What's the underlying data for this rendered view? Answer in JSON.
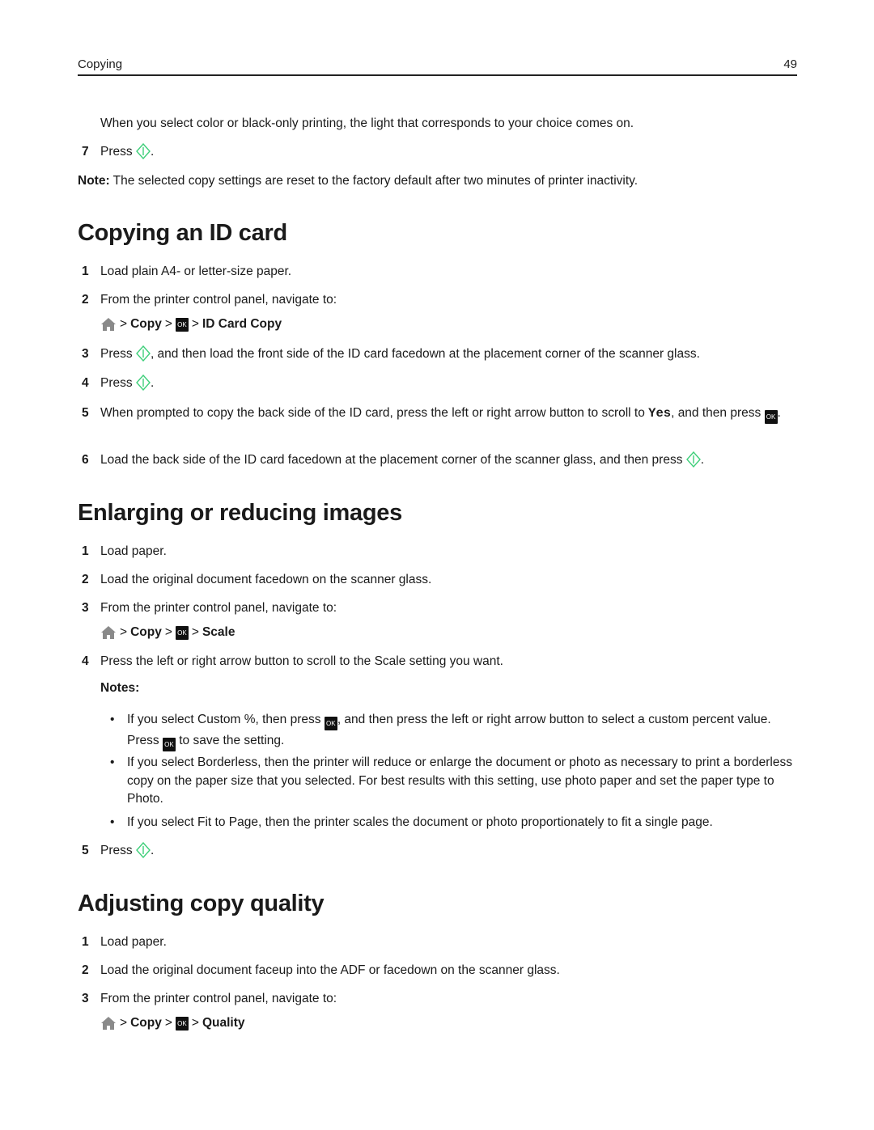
{
  "header": {
    "section": "Copying",
    "page_number": "49"
  },
  "intro": {
    "continued_text": "When you select color or black-only printing, the light that corresponds to your choice comes on.",
    "step7_num": "7",
    "step7_text": "Press",
    "note_label": "Note:",
    "note_text": " The selected copy settings are reset to the factory default after two minutes of printer inactivity."
  },
  "icons": {
    "start": "start-icon",
    "home": "home-icon",
    "ok": "OK"
  },
  "colors": {
    "start_green": "#3ecf7a",
    "home_gray": "#8a8a8a",
    "ok_bg": "#111111"
  },
  "sections": [
    {
      "title": "Copying an ID card",
      "steps": [
        {
          "num": "1",
          "text": "Load plain A4- or letter-size paper."
        },
        {
          "num": "2",
          "text": "From the printer control panel, navigate to:"
        },
        {
          "num": "3",
          "pre": "Press ",
          "post": ", and then load the front side of the ID card facedown at the placement corner of the scanner glass."
        },
        {
          "num": "4",
          "pre": "Press ",
          "post": "."
        },
        {
          "num": "5",
          "pre": "When prompted to copy the back side of the ID card, press the left or right arrow button to scroll to ",
          "mono": "Yes",
          "post": ", and then press ",
          "end": "."
        },
        {
          "num": "6",
          "pre": "Load the back side of the ID card facedown at the placement corner of the scanner glass, and then press ",
          "post": "."
        }
      ],
      "path": {
        "sep": ">",
        "item1": "Copy",
        "item2": "ID Card Copy"
      }
    },
    {
      "title": "Enlarging or reducing images",
      "steps": [
        {
          "num": "1",
          "text": "Load paper."
        },
        {
          "num": "2",
          "text": "Load the original document facedown on the scanner glass."
        },
        {
          "num": "3",
          "text": "From the printer control panel, navigate to:"
        },
        {
          "num": "4",
          "text": "Press the left or right arrow button to scroll to the Scale setting you want."
        },
        {
          "num": "5",
          "pre": "Press ",
          "post": "."
        }
      ],
      "path": {
        "sep": ">",
        "item1": "Copy",
        "item2": "Scale"
      },
      "notes_label": "Notes:",
      "notes": [
        {
          "a": "If you select Custom %, then press ",
          "b": ", and then press the left or right arrow button to select a custom percent value. Press ",
          "c": " to save the setting."
        },
        {
          "text": "If you select Borderless, then the printer will reduce or enlarge the document or photo as necessary to print a borderless copy on the paper size that you selected. For best results with this setting, use photo paper and set the paper type to Photo."
        },
        {
          "text": "If you select Fit to Page, then the printer scales the document or photo proportionately to fit a single page."
        }
      ]
    },
    {
      "title": "Adjusting copy quality",
      "steps": [
        {
          "num": "1",
          "text": "Load paper."
        },
        {
          "num": "2",
          "text": "Load the original document faceup into the ADF or facedown on the scanner glass."
        },
        {
          "num": "3",
          "text": "From the printer control panel, navigate to:"
        }
      ],
      "path": {
        "sep": ">",
        "item1": "Copy",
        "item2": "Quality"
      }
    }
  ]
}
